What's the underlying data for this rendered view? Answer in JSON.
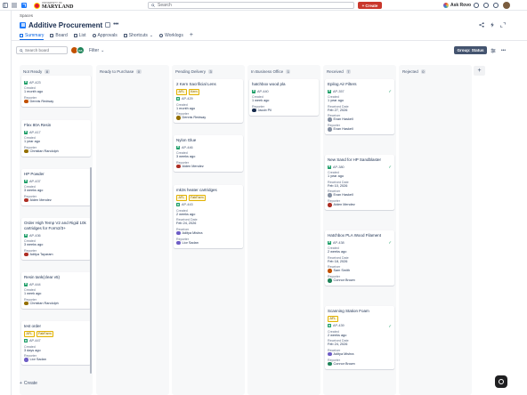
{
  "topbar": {
    "logo_small": "UNIVERSITY OF",
    "logo_text": "MARYLAND",
    "search_placeholder": "Search",
    "create_label": "Create",
    "ask_rovo_label": "Ask Rovo"
  },
  "header": {
    "breadcrumb": "Spaces",
    "title": "Additive Procurement",
    "tabs": [
      {
        "label": "Summary",
        "active": true
      },
      {
        "label": "Board",
        "active": false
      },
      {
        "label": "List",
        "active": false
      },
      {
        "label": "Approvals",
        "active": false
      },
      {
        "label": "Shortcuts",
        "active": false
      },
      {
        "label": "Worklogs",
        "active": false
      }
    ]
  },
  "toolbar": {
    "search_placeholder": "Search board",
    "filter_label": "Filter",
    "group_label": "Group: Status",
    "avatar_initials": [
      "",
      "RA"
    ]
  },
  "columns": [
    {
      "title": "Not Ready",
      "count": "8"
    },
    {
      "title": "Ready to Purchase",
      "count": "0"
    },
    {
      "title": "Pending Delivery",
      "count": "3"
    },
    {
      "title": "In Business Office",
      "count": "1"
    },
    {
      "title": "Received",
      "count": "7"
    },
    {
      "title": "Rejected",
      "count": "0"
    }
  ],
  "cards": {
    "c1": {
      "key": "AP-423",
      "created_label": "Created",
      "created": "1 month ago",
      "reporter_label": "Reporter",
      "reporter": "Dennis Redway"
    },
    "c2": {
      "title": "Flex 80A Resin",
      "key": "AP-417",
      "created_label": "Created",
      "created": "1 year ago",
      "reporter_label": "Reporter",
      "reporter": "Christian Randolph"
    },
    "c3": {
      "title": "HP Powder",
      "key": "AP-437",
      "created_label": "Created",
      "created": "3 weeks ago",
      "reporter_label": "Reporter",
      "reporter": "Aiden Mendez"
    },
    "c4": {
      "title": "Order High Temp V2 and Rigid 10k cartridges for Form2/3+",
      "key": "AP-436",
      "created_label": "Created",
      "created": "3 weeks ago",
      "reporter_label": "Reporter",
      "reporter": "Aditya Tayaram"
    },
    "c5": {
      "title": "Resin tank(clear v5)",
      "key": "AP-444",
      "created_label": "Created",
      "created": "1 week ago",
      "reporter_label": "Reporter",
      "reporter": "Christian Randolph"
    },
    "c6": {
      "title": "test order",
      "tags": [
        "AFL",
        "FabFarm"
      ],
      "key": "AP-447",
      "created_label": "Created",
      "created": "3 days ago",
      "reporter_label": "Reporter",
      "reporter": "Lior Sadan"
    },
    "c7": {
      "title": "2 Kern Sacrificial Lens",
      "tags": [
        "AFL",
        "Kern"
      ],
      "key": "AP-429",
      "created_label": "Created",
      "created": "1 month ago",
      "reporter_label": "Reporter",
      "reporter": "Dennis Redway"
    },
    "c8": {
      "title": "Nylon Glue",
      "key": "AP-446",
      "created_label": "Created",
      "created": "3 weeks ago",
      "reporter_label": "Reporter",
      "reporter": "Aiden Mendez"
    },
    "c9": {
      "title": "mk3s heater cartridges",
      "tags": [
        "AFL",
        "FabFarm"
      ],
      "key": "AP-443",
      "created_label": "Created",
      "created": "2 weeks ago",
      "received_label": "Received Date",
      "received": "Feb 24, 2026",
      "receiver_label": "Receiver",
      "receiver": "Aditya Mishra",
      "reporter_label": "Reporter",
      "reporter": "Lior Sadan"
    },
    "c10": {
      "title": "hatchbox wood pla",
      "key": "AP-440",
      "created_label": "Created",
      "created": "1 week ago",
      "reporter_label": "Reporter",
      "reporter": "Jacob Pil"
    },
    "c11": {
      "title": "Epilog Air Filters",
      "key": "AP-357",
      "created_label": "Created",
      "created": "1 year ago",
      "received_label": "Received Date",
      "received": "Feb 27, 2026",
      "receiver_label": "Receiver",
      "receiver": "Evan Haskell",
      "reporter_label": "Reporter",
      "reporter": "Evan Haskell"
    },
    "c12": {
      "title": "New Sand for HP Sandblaster",
      "key": "AP-380",
      "created_label": "Created",
      "created": "1 year ago",
      "received_label": "Received Date",
      "received": "Feb 10, 2026",
      "receiver_label": "Receiver",
      "receiver": "Evan Haskell",
      "reporter_label": "Reporter",
      "reporter": "Aiden Mendez"
    },
    "c13": {
      "title": "Hatchbox PLA Wood Filament",
      "key": "AP-438",
      "created_label": "Created",
      "created": "2 weeks ago",
      "received_label": "Received Date",
      "received": "Feb 18, 2026",
      "receiver_label": "Receiver",
      "receiver": "Sam Smith",
      "reporter_label": "Reporter",
      "reporter": "Connor Brown"
    },
    "c14": {
      "title": "Scanning Station Foam",
      "tags": [
        "AFL"
      ],
      "key": "AP-439",
      "created_label": "Created",
      "created": "2 weeks ago",
      "received_label": "Received Date",
      "received": "Feb 24, 2026",
      "receiver_label": "Receiver",
      "receiver": "Aditya Mishra",
      "reporter_label": "Reporter",
      "reporter": "Connor Brown"
    }
  },
  "footer": {
    "create_label": "Create"
  },
  "colors": {
    "accent": "#0c66e4",
    "create": "#c9372c",
    "story": "#22a06b"
  }
}
